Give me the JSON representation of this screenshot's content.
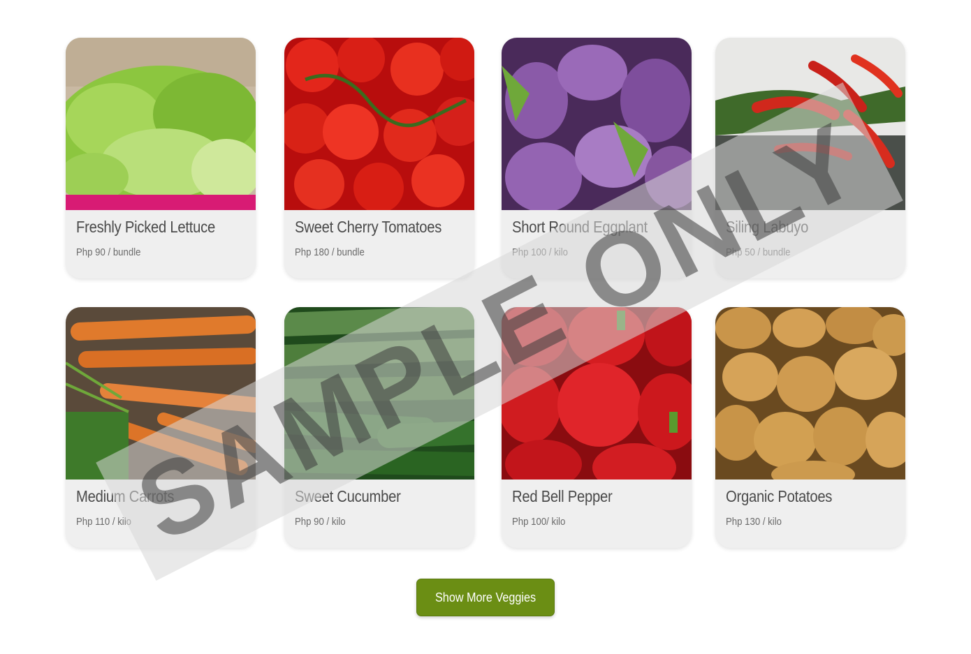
{
  "products": [
    {
      "name": "Freshly Picked Lettuce",
      "price": "Php 90 / bundle",
      "image": "lettuce-photo"
    },
    {
      "name": "Sweet Cherry Tomatoes",
      "price": "Php 180 / bundle",
      "image": "tomatoes-photo"
    },
    {
      "name": "Short Round Eggplant",
      "price": "Php 100 / kilo",
      "image": "eggplant-photo"
    },
    {
      "name": "Siling Labuyo",
      "price": "Php 50 / bundle",
      "image": "chili-photo"
    },
    {
      "name": "Medium Carrots",
      "price": "Php 110 / kilo",
      "image": "carrots-photo"
    },
    {
      "name": "Sweet Cucumber",
      "price": "Php 90 / kilo",
      "image": "cucumber-photo"
    },
    {
      "name": "Red Bell Pepper",
      "price": "Php 100/ kilo",
      "image": "bell-pepper-photo"
    },
    {
      "name": "Organic Potatoes",
      "price": "Php 130 / kilo",
      "image": "potatoes-photo"
    }
  ],
  "show_more": {
    "label": "Show More Veggies"
  },
  "watermark": {
    "text": "SAMPLE ONLY"
  },
  "colors": {
    "accent": "#6b8e14",
    "card_bg": "#efefef"
  }
}
